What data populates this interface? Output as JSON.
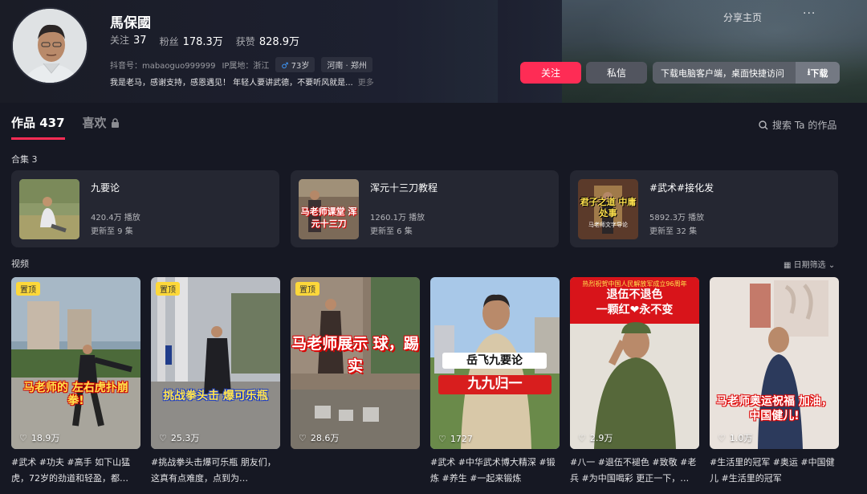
{
  "profile": {
    "name": "馬保國",
    "follow_label": "关注",
    "follow_count": "37",
    "fans_label": "粉丝",
    "fans_count": "178.3万",
    "likes_label": "获赞",
    "likes_count": "828.9万",
    "douyin_id": "抖音号：mabaoguo999999",
    "ip": "IP属地：浙江",
    "age": "73岁",
    "location": "河南 · 郑州",
    "bio": "我是老马，感谢支持，感恩遇见！ 年轻人要讲武德，不要听风就是...",
    "bio_more": "更多"
  },
  "header": {
    "share": "分享主页",
    "more": "···",
    "follow_button": "关注",
    "message_button": "私信",
    "download_text": "下载电脑客户端，桌面快捷访问",
    "download_button": "下载"
  },
  "tabs": {
    "works": "作品 437",
    "likes": "喜欢",
    "search": "搜索 Ta 的作品"
  },
  "collections": {
    "title": "合集 3",
    "items": [
      {
        "title": "九要论",
        "plays": "420.4万 播放",
        "updated": "更新至 9 集"
      },
      {
        "title": "浑元十三刀教程",
        "plays": "1260.1万 播放",
        "updated": "更新至 6 集",
        "thumb_text": "马老师课堂 浑元十三刀"
      },
      {
        "title": "#武术#接化发",
        "plays": "5892.3万 播放",
        "updated": "更新至 32 集",
        "thumb_text": "君子之道 中庸处事",
        "thumb_sub": "马老师文字导论"
      }
    ]
  },
  "videos": {
    "title": "视频",
    "date_filter": "日期筛选",
    "pin_label": "置顶",
    "items": [
      {
        "likes": "18.9万",
        "caption": "马老师的 左右虎扑崩拳!",
        "desc": "#武术 #功夫 #高手 如下山猛虎，72岁的劲道和轻盈，都…"
      },
      {
        "likes": "25.3万",
        "caption": "挑战拳头击 爆可乐瓶",
        "desc": "#挑战拳头击爆可乐瓶 朋友们，这真有点难度，点到为…"
      },
      {
        "likes": "28.6万",
        "caption": "马老师展示 球，踢实",
        "desc": ""
      },
      {
        "likes": "1727",
        "caption": "岳飞九要论",
        "caption2": "九九归一",
        "desc": "#武术 #中华武术博大精深 #锻炼 #养生 #一起来锻炼"
      },
      {
        "likes": "2.9万",
        "banner": "热烈祝贺中国人民解放军成立96周年",
        "caption": "退伍不退色",
        "caption2": "一颗红❤永不变",
        "desc": "#八一 #退伍不褪色 #致敬 #老兵 #为中国喝彩 更正一下，…"
      },
      {
        "likes": "1.0万",
        "caption": "马老师奥运祝福 加油，中国健儿!",
        "desc": "#生活里的冠军 #奥运 #中国健儿 #生活里的冠军"
      }
    ]
  }
}
